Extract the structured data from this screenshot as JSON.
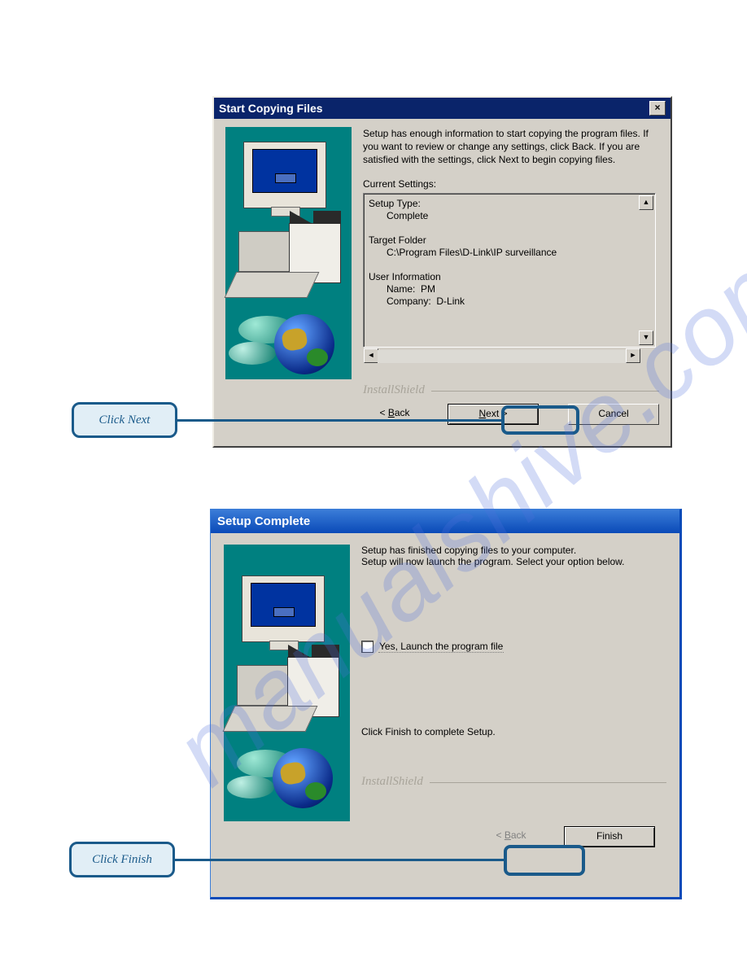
{
  "watermark": "manualshive.com",
  "dlg1": {
    "title": "Start Copying Files",
    "para": "Setup has enough information to start copying the program files. If you want to review or change any settings, click Back.  If you are satisfied with the settings, click Next to begin copying files.",
    "current_settings_label": "Current Settings:",
    "settings": {
      "setup_type_label": "Setup Type:",
      "setup_type_value": "Complete",
      "target_folder_label": "Target Folder",
      "target_folder_value": "C:\\Program Files\\D-Link\\IP surveillance",
      "user_info_label": "User Information",
      "user_name_label": "Name:",
      "user_name_value": "PM",
      "company_label": "Company:",
      "company_value": "D-Link"
    },
    "brand": "InstallShield",
    "back": "< Back",
    "next": "Next >",
    "cancel": "Cancel",
    "close_x": "×"
  },
  "callout1": "Click Next",
  "dlg2": {
    "title": "Setup Complete",
    "line1": "Setup has finished copying files to your computer.",
    "line2": "Setup will now launch the program. Select your option below.",
    "chk_label": "Yes, Launch the program file",
    "finish_text": "Click Finish to complete Setup.",
    "brand": "InstallShield",
    "back": "< Back",
    "finish": "Finish"
  },
  "callout2": "Click Finish"
}
